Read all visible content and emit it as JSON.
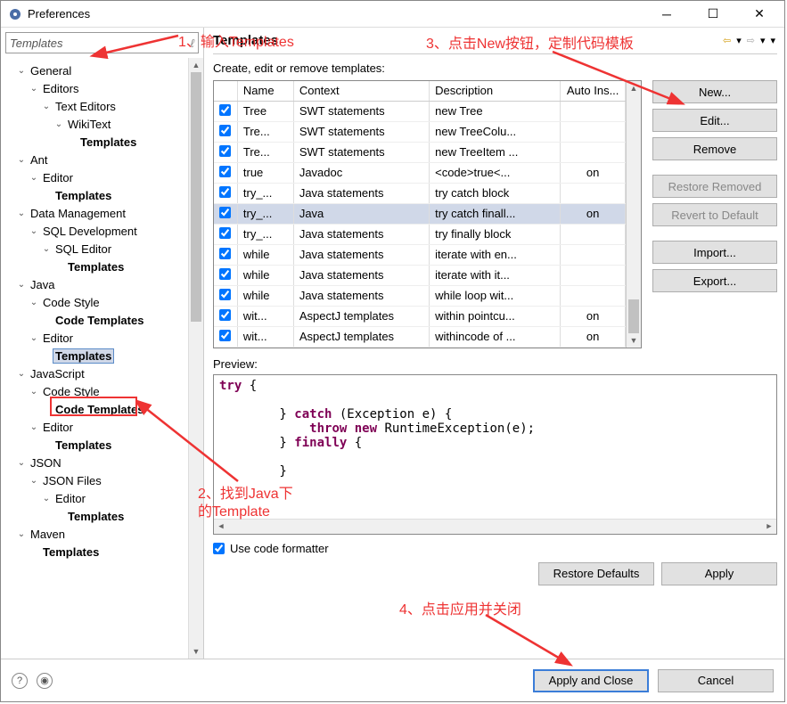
{
  "window": {
    "title": "Preferences"
  },
  "search": {
    "value": "Templates"
  },
  "tree": [
    {
      "label": "General",
      "indent": 1,
      "toggle": "v"
    },
    {
      "label": "Editors",
      "indent": 2,
      "toggle": "v"
    },
    {
      "label": "Text Editors",
      "indent": 3,
      "toggle": "v"
    },
    {
      "label": "WikiText",
      "indent": 4,
      "toggle": "v"
    },
    {
      "label": "Templates",
      "indent": 5,
      "bold": true
    },
    {
      "label": "Ant",
      "indent": 1,
      "toggle": "v"
    },
    {
      "label": "Editor",
      "indent": 2,
      "toggle": "v"
    },
    {
      "label": "Templates",
      "indent": 3,
      "bold": true
    },
    {
      "label": "Data Management",
      "indent": 1,
      "toggle": "v"
    },
    {
      "label": "SQL Development",
      "indent": 2,
      "toggle": "v"
    },
    {
      "label": "SQL Editor",
      "indent": 3,
      "toggle": "v"
    },
    {
      "label": "Templates",
      "indent": 4,
      "bold": true
    },
    {
      "label": "Java",
      "indent": 1,
      "toggle": "v"
    },
    {
      "label": "Code Style",
      "indent": 2,
      "toggle": "v"
    },
    {
      "label": "Code Templates",
      "indent": 3,
      "bold": true
    },
    {
      "label": "Editor",
      "indent": 2,
      "toggle": "v"
    },
    {
      "label": "Templates",
      "indent": 3,
      "bold": true,
      "selected": true
    },
    {
      "label": "JavaScript",
      "indent": 1,
      "toggle": "v"
    },
    {
      "label": "Code Style",
      "indent": 2,
      "toggle": "v"
    },
    {
      "label": "Code Templates",
      "indent": 3,
      "bold": true
    },
    {
      "label": "Editor",
      "indent": 2,
      "toggle": "v"
    },
    {
      "label": "Templates",
      "indent": 3,
      "bold": true
    },
    {
      "label": "JSON",
      "indent": 1,
      "toggle": "v"
    },
    {
      "label": "JSON Files",
      "indent": 2,
      "toggle": "v"
    },
    {
      "label": "Editor",
      "indent": 3,
      "toggle": "v"
    },
    {
      "label": "Templates",
      "indent": 4,
      "bold": true
    },
    {
      "label": "Maven",
      "indent": 1,
      "toggle": "v"
    },
    {
      "label": "Templates",
      "indent": 2,
      "bold": true
    }
  ],
  "page": {
    "title": "Templates",
    "subtitle": "Create, edit or remove templates:"
  },
  "columns": {
    "name": "Name",
    "context": "Context",
    "description": "Description",
    "auto": "Auto Ins..."
  },
  "rows": [
    {
      "chk": true,
      "name": "Tree",
      "ctx": "SWT statements",
      "desc": "new Tree",
      "auto": ""
    },
    {
      "chk": true,
      "name": "Tre...",
      "ctx": "SWT statements",
      "desc": "new TreeColu...",
      "auto": ""
    },
    {
      "chk": true,
      "name": "Tre...",
      "ctx": "SWT statements",
      "desc": "new TreeItem ...",
      "auto": ""
    },
    {
      "chk": true,
      "name": "true",
      "ctx": "Javadoc",
      "desc": "<code>true<...",
      "auto": "on"
    },
    {
      "chk": true,
      "name": "try_...",
      "ctx": "Java statements",
      "desc": "try catch block",
      "auto": ""
    },
    {
      "chk": true,
      "name": "try_...",
      "ctx": "Java",
      "desc": "try catch finall...",
      "auto": "on",
      "selected": true
    },
    {
      "chk": true,
      "name": "try_...",
      "ctx": "Java statements",
      "desc": "try finally block",
      "auto": ""
    },
    {
      "chk": true,
      "name": "while",
      "ctx": "Java statements",
      "desc": "iterate with en...",
      "auto": ""
    },
    {
      "chk": true,
      "name": "while",
      "ctx": "Java statements",
      "desc": "iterate with it...",
      "auto": ""
    },
    {
      "chk": true,
      "name": "while",
      "ctx": "Java statements",
      "desc": "while loop wit...",
      "auto": ""
    },
    {
      "chk": true,
      "name": "wit...",
      "ctx": "AspectJ templates",
      "desc": "within pointcu...",
      "auto": "on"
    },
    {
      "chk": true,
      "name": "wit...",
      "ctx": "AspectJ templates",
      "desc": "withincode of ...",
      "auto": "on"
    }
  ],
  "buttons": {
    "new": "New...",
    "edit": "Edit...",
    "remove": "Remove",
    "restore_removed": "Restore Removed",
    "revert": "Revert to Default",
    "import": "Import...",
    "export": "Export...",
    "restore_defaults": "Restore Defaults",
    "apply": "Apply",
    "apply_close": "Apply and Close",
    "cancel": "Cancel"
  },
  "preview": {
    "label": "Preview:"
  },
  "formatter": {
    "label": "Use code formatter",
    "checked": true
  },
  "annotations": {
    "a1": "1、输入Templates",
    "a2a": "2、找到Java下",
    "a2b": "的Template",
    "a3": "3、点击New按钮，定制代码模板",
    "a4": "4、点击应用并关闭"
  }
}
